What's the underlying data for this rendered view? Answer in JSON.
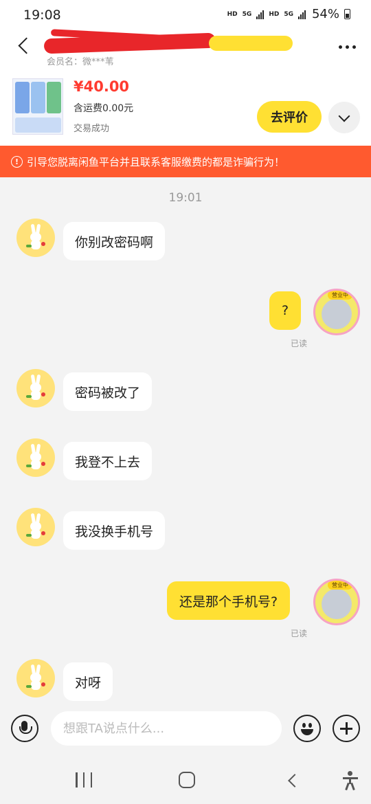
{
  "status_bar": {
    "time": "19:08",
    "indicators": [
      "HD",
      "5G",
      "HD",
      "5G"
    ],
    "battery": "54%"
  },
  "header": {
    "member_name": "会员名：微***苇"
  },
  "product": {
    "price": "¥40.00",
    "shipping": "含运费0.00元",
    "trade_status": "交易成功",
    "review_button": "去评价"
  },
  "warning": {
    "icon": "!",
    "text": "引导您脱离闲鱼平台并且联系客服缴费的都是诈骗行为！"
  },
  "chat": {
    "timestamp": "19:01",
    "messages": [
      {
        "side": "left",
        "text": "你别改密码啊"
      },
      {
        "side": "right",
        "text": "?",
        "status": "已读"
      },
      {
        "side": "left",
        "text": "密码被改了"
      },
      {
        "side": "left",
        "text": "我登不上去"
      },
      {
        "side": "left",
        "text": "我没换手机号"
      },
      {
        "side": "right",
        "text": "还是那个手机号?",
        "status": "已读"
      },
      {
        "side": "left",
        "text": "对呀"
      }
    ],
    "own_avatar_badge": "营业中"
  },
  "input_bar": {
    "placeholder": "想跟TA说点什么..."
  },
  "colors": {
    "accent_yellow": "#ffe033",
    "warning_orange": "#ff5a2f",
    "price_red": "#ff3b30"
  },
  "icons": [
    "back-icon",
    "more-icon",
    "chevron-down-icon",
    "alert-icon",
    "voice-icon",
    "emoji-icon",
    "plus-icon",
    "recent-apps-icon",
    "home-icon",
    "nav-back-icon",
    "accessibility-icon"
  ]
}
